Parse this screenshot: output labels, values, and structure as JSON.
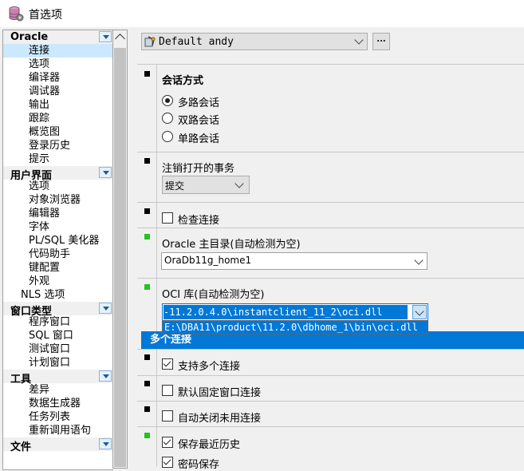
{
  "window": {
    "title": "首选项"
  },
  "nav": {
    "groups": [
      {
        "label": "Oracle",
        "items": [
          "连接",
          "选项",
          "编译器",
          "调试器",
          "输出",
          "跟踪",
          "概览图",
          "登录历史",
          "提示"
        ]
      },
      {
        "label": "用户界面",
        "items": [
          "选项",
          "对象浏览器",
          "编辑器",
          "字体",
          "PL/SQL 美化器",
          "代码助手",
          "键配置",
          "外观",
          "NLS 选项"
        ]
      },
      {
        "label": "窗口类型",
        "items": [
          "程序窗口",
          "SQL 窗口",
          "测试窗口",
          "计划窗口"
        ]
      },
      {
        "label": "工具",
        "items": [
          "差异",
          "数据生成器",
          "任务列表",
          "重新调用语句"
        ]
      },
      {
        "label": "文件",
        "items": []
      }
    ],
    "selected": "连接"
  },
  "toolbar": {
    "profile": "Default andy",
    "more_button": "..."
  },
  "sections": {
    "session": {
      "title": "会话方式",
      "options": [
        "多路会话",
        "双路会话",
        "单路会话"
      ],
      "selected": "多路会话"
    },
    "logoff": {
      "title": "注销打开的事务",
      "value": "提交"
    },
    "check_connection": {
      "label": "检查连接",
      "checked": false
    },
    "oracle_home": {
      "title": "Oracle 主目录(自动检测为空)",
      "value": "OraDb11g_home1"
    },
    "oci": {
      "title": "OCI 库(自动检测为空)",
      "value": "-11.2.0.4.0\\instantclient_11_2\\oci.dll",
      "dropdown_option": "E:\\DBA11\\product\\11.2.0\\dbhome_1\\bin\\oci.dll"
    },
    "multi": {
      "title": "多个连接",
      "options": [
        {
          "label": "支持多个连接",
          "checked": true
        },
        {
          "label": "默认固定窗口连接",
          "checked": false
        },
        {
          "label": "自动关闭未用连接",
          "checked": false
        },
        {
          "label": "保存最近历史",
          "checked": true
        },
        {
          "label": "密码保存",
          "checked": true
        }
      ]
    }
  },
  "colors": {
    "accent": "#0078d7",
    "selected_row": "#cce8ff",
    "changed_marker": "#22c322",
    "default_marker": "#000000"
  }
}
